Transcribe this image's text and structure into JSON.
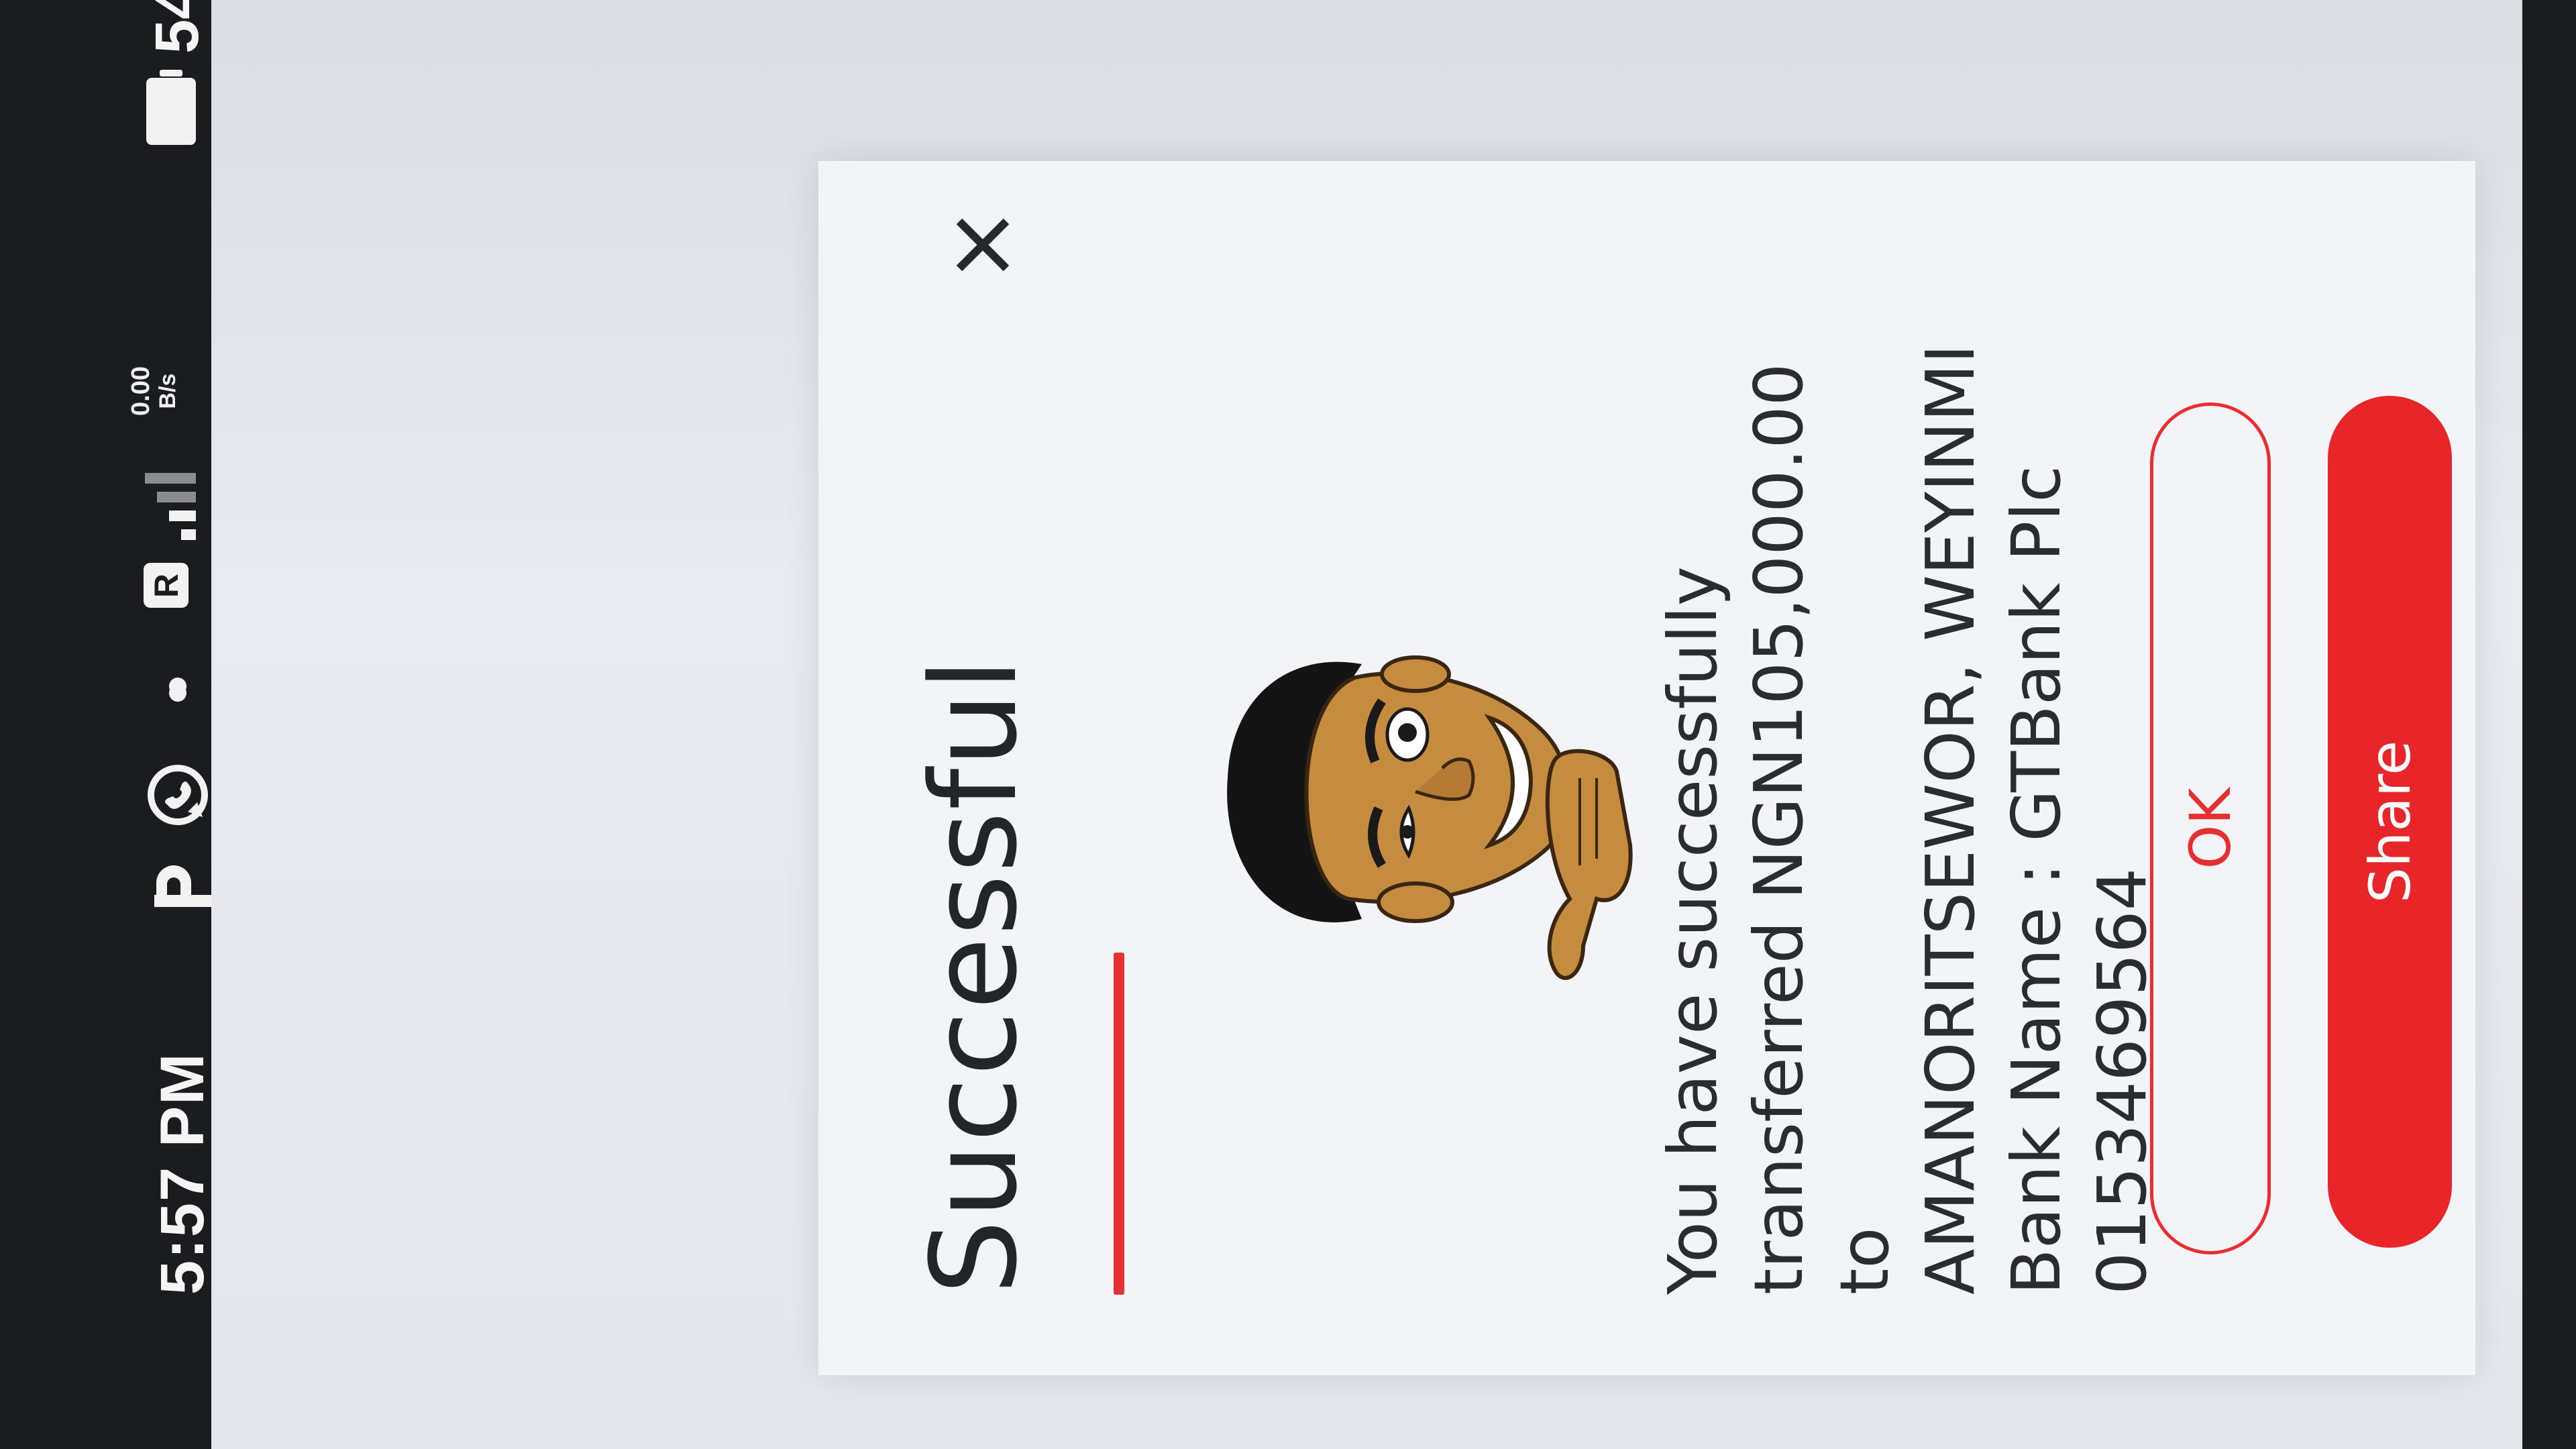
{
  "status_bar": {
    "time": "5:57 PM",
    "net_speed": "0.00",
    "net_unit": "B/s",
    "battery": "54",
    "icons": [
      "p-icon",
      "whatsapp-icon",
      "notification-dot-icon",
      "roaming-icon",
      "signal-icon",
      "battery-icon"
    ]
  },
  "dialog": {
    "title": "Successful",
    "message_lines": [
      "You have successfully",
      "transferred NGN105,000.00",
      "to",
      "AMANORITSEWOR, WEYINMI",
      "Bank Name : GTBank Plc",
      "0153469564"
    ],
    "ok_label": "OK",
    "share_label": "Share"
  },
  "colors": {
    "accent": "#e8262a",
    "title_text": "#232628",
    "card_bg": "#f3f4f7"
  }
}
